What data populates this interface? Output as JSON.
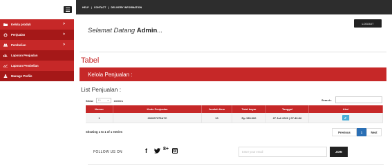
{
  "topbar": {
    "links": [
      "HELP",
      "CONTACT",
      "DELIVERY INFORMATION"
    ],
    "separator": "|"
  },
  "sidebar": {
    "items": [
      {
        "label": "Kelola produk",
        "icon": "folder-icon",
        "chevron": ">"
      },
      {
        "label": "Penjualan",
        "icon": "refresh-icon",
        "chevron": ">"
      },
      {
        "label": "Pembelian",
        "icon": "users-icon",
        "chevron": ">"
      },
      {
        "label": "Laporan Penjualan",
        "icon": "chart-bar-icon"
      },
      {
        "label": "Laporan Pembelian",
        "icon": "chart-line-icon"
      },
      {
        "label": "Manage Profile",
        "icon": "user-icon"
      }
    ]
  },
  "header": {
    "welcome_text": "Selamat Datang",
    "welcome_name": "Admin",
    "welcome_suffix": "...",
    "logout_label": "LOGOUT"
  },
  "main": {
    "section_title": "Tabel",
    "band_title": "Kelola Penjualan :",
    "list_title": "List Penjualan :",
    "show_label": "Show",
    "entries_value": "10",
    "entries_label": "entries",
    "search_label": "Search:",
    "table": {
      "columns": [
        "Nomor",
        "Kode Penjualan",
        "Jumlah Item",
        "Total bayar",
        "Tanggal",
        "Aksi"
      ],
      "rows": [
        [
          "1",
          "202007275A7C",
          "10",
          "Rp 150.000",
          "27 Juli 2020 | 07:40:06",
          "edit"
        ]
      ]
    },
    "info_text": "Showing 1 to 1 of 1 entries",
    "pager": {
      "prev": "Previous",
      "page": "1",
      "next": "Next"
    }
  },
  "footer": {
    "follow_label": "FOLLOW US ON",
    "social": [
      "f",
      "•",
      "8+",
      "▣"
    ],
    "email_placeholder": "Enter your email",
    "join_label": "JOIN"
  },
  "colors": {
    "accent": "#c62828",
    "topbar": "#2d2d2d",
    "pager_active": "#2a6fb5",
    "edit_button": "#4aaed8"
  }
}
